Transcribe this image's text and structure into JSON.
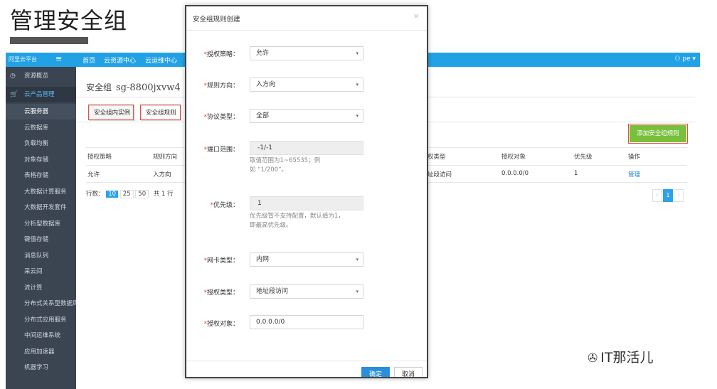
{
  "slide": {
    "title": "管理安全组"
  },
  "header": {
    "brand": "阿里云平台",
    "menu_icon": "≡",
    "nav": [
      "首页",
      "云资源中心",
      "云运维中心"
    ],
    "user": "pe"
  },
  "sidebar": {
    "top": "资源概览",
    "section": "云产品管理",
    "items": [
      "云服务器",
      "云数据库",
      "负载均衡",
      "对象存储",
      "表格存储",
      "大数据计算服务",
      "大数据开发套件",
      "分析型数据库",
      "键值存储",
      "消息队列",
      "采云间",
      "流计算",
      "分布式关系型数据库",
      "分布式应用服务",
      "中间运维系统",
      "应用加速器",
      "机器学习"
    ]
  },
  "main": {
    "crumb_label": "安全组",
    "crumb_id": "sg-8800jxvw4",
    "tabs": [
      "安全组内实例",
      "安全组规则"
    ],
    "add_rule": "添加安全组规则",
    "columns": [
      "授权策略",
      "规则方向",
      "权类型",
      "授权对象",
      "优先级",
      "操作"
    ],
    "row": {
      "policy": "允许",
      "direction": "入方向",
      "type": "址段访问",
      "object": "0.0.0.0/0",
      "priority": "1",
      "action": "管理"
    },
    "pager": {
      "label": "行数：",
      "sizes": [
        "10",
        "25",
        "50"
      ],
      "total": "共 1 行",
      "page": "1"
    }
  },
  "modal": {
    "title": "安全组规则创建",
    "close": "×",
    "fields": {
      "policy": {
        "label": "授权策略：",
        "value": "允许"
      },
      "direction": {
        "label": "规则方向：",
        "value": "入方向"
      },
      "protocol": {
        "label": "协议类型：",
        "value": "全部"
      },
      "port": {
        "label": "端口范围：",
        "value": "-1/-1",
        "hint1": "取值范围为1~65535；例",
        "hint2": "如 “1/200”。"
      },
      "priority": {
        "label": "优先级：",
        "value": "1",
        "hint1": "优先级暂不支持配置，默认值为1，",
        "hint2": "即最高优先级。"
      },
      "nic": {
        "label": "网卡类型：",
        "value": "内网"
      },
      "auth_type": {
        "label": "授权类型：",
        "value": "地址段访问"
      },
      "auth_obj": {
        "label": "授权对象：",
        "value": "0.0.0.0/0"
      }
    },
    "ok": "确定",
    "cancel": "取消"
  },
  "watermark": {
    "text": "IT那活儿"
  }
}
